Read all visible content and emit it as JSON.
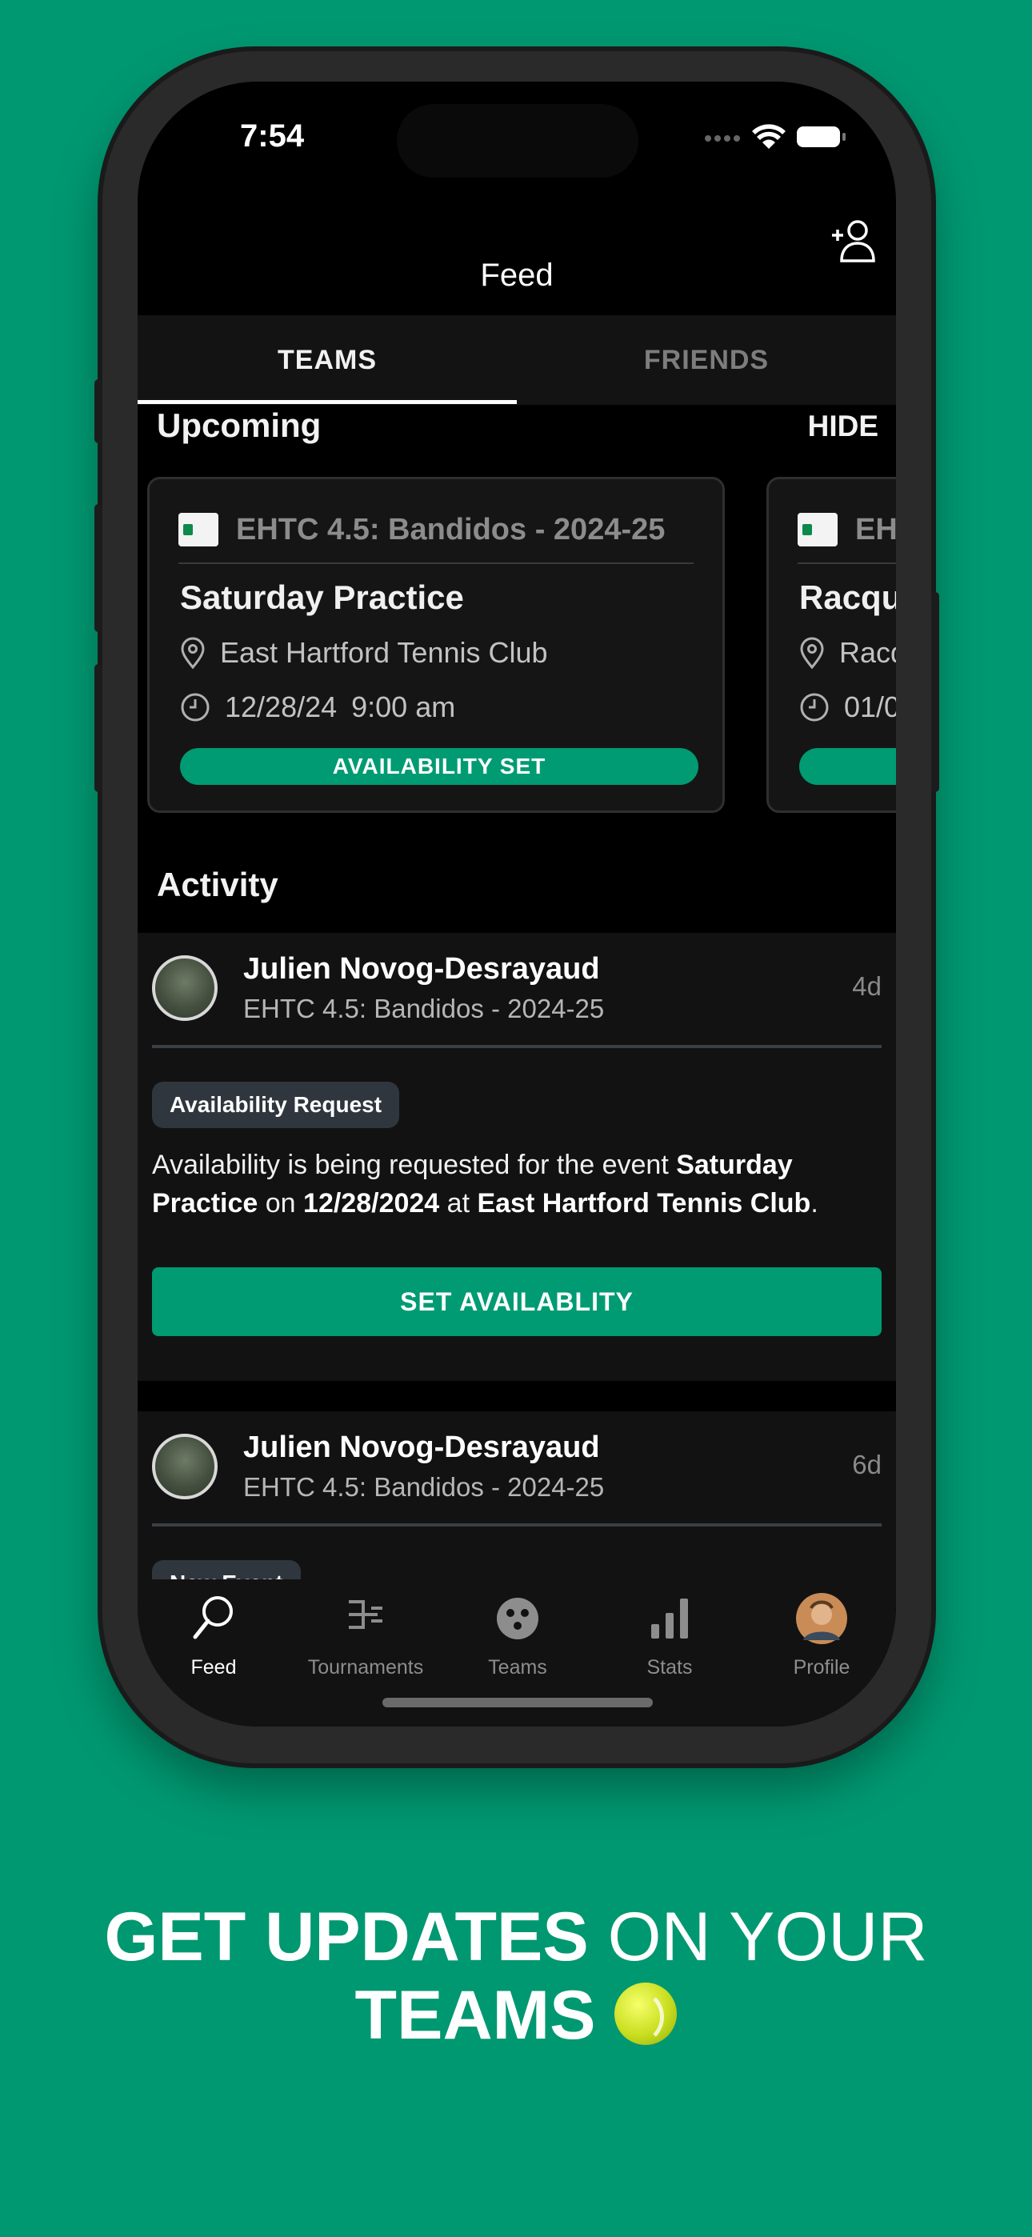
{
  "status_bar": {
    "time": "7:54"
  },
  "nav": {
    "title": "Feed",
    "add_friend_icon": "add-friend-icon"
  },
  "tabs": [
    {
      "label": "TEAMS",
      "active": true
    },
    {
      "label": "FRIENDS",
      "active": false
    }
  ],
  "upcoming": {
    "title": "Upcoming",
    "hide_label": "HIDE",
    "cards": [
      {
        "team": "EHTC 4.5: Bandidos - 2024-25",
        "event": "Saturday Practice",
        "location": "East Hartford Tennis Club",
        "date": "12/28/24",
        "time": "9:00 am",
        "status": "AVAILABILITY SET"
      },
      {
        "team": "EH",
        "event": "Racqu",
        "location": "Racq",
        "date": "01/0",
        "time": "",
        "status": ""
      }
    ]
  },
  "activity": {
    "title": "Activity",
    "items": [
      {
        "name": "Julien Novog-Desrayaud",
        "team": "EHTC 4.5: Bandidos - 2024-25",
        "age": "4d",
        "badge": "Availability Request",
        "text_1": "Availability is being requested for the event ",
        "event": "Saturday Practice",
        "text_2": " on ",
        "date": "12/28/2024",
        "text_3": " at ",
        "location": "East Hartford Tennis Club",
        "text_4": ".",
        "button": "SET AVAILABLITY"
      },
      {
        "name": "Julien Novog-Desrayaud",
        "team": "EHTC 4.5: Bandidos - 2024-25",
        "age": "6d",
        "badge": "New Event"
      }
    ]
  },
  "tab_bar": [
    {
      "label": "Feed",
      "icon": "racket-icon",
      "active": true
    },
    {
      "label": "Tournaments",
      "icon": "bracket-icon",
      "active": false
    },
    {
      "label": "Teams",
      "icon": "teams-icon",
      "active": false
    },
    {
      "label": "Stats",
      "icon": "stats-icon",
      "active": false
    },
    {
      "label": "Profile",
      "icon": "avatar",
      "active": false
    }
  ],
  "promo": {
    "bold_1": "GET UPDATES",
    "light": "ON YOUR",
    "bold_2": "TEAMS",
    "emoji": "tennis-ball-icon"
  },
  "colors": {
    "background": "#009871",
    "accent": "#009b73",
    "screen": "#000000"
  }
}
